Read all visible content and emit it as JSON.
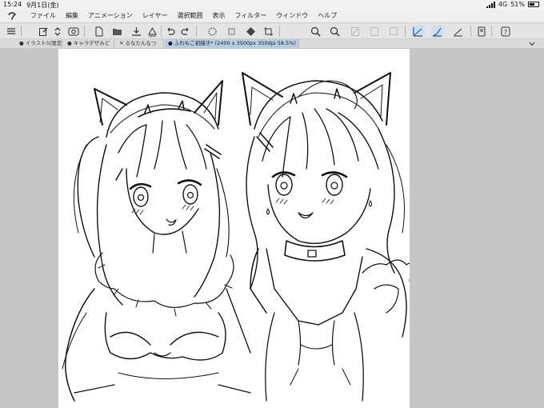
{
  "status": {
    "time": "15:24",
    "date": "9月1日(金)",
    "network": "4G",
    "battery": "51%",
    "battery_level": 0.51
  },
  "menu": {
    "items": [
      "ファイル",
      "編集",
      "アニメーション",
      "レイヤー",
      "選択範囲",
      "表示",
      "フィルター",
      "ウィンドウ",
      "ヘルプ"
    ]
  },
  "toolbar": {
    "icons": [
      "menu-icon",
      "new-canvas-icon",
      "arrows-icon",
      "lasso-icon",
      "new-page-icon",
      "open-folder-icon",
      "save-icon",
      "upload-icon",
      "undo-icon",
      "redo-icon",
      "sparkle-icon",
      "transform-icon",
      "fill-icon",
      "crop-icon",
      "zoom-in-icon",
      "zoom-out-icon",
      "disabled-icon",
      "invert-icon",
      "square-icon",
      "pen-pressure-icon",
      "brush-icon",
      "ruler-icon",
      "device-icon",
      "help-icon"
    ]
  },
  "tabs": [
    {
      "label": "● イラスト5(限定"
    },
    {
      "label": "● キャラデザみど"
    },
    {
      "label": "✕ るなたんなつ"
    },
    {
      "label": "● ふわもこ初描き* (2400 x 3500px 350dpi 58.5%)"
    }
  ],
  "colors": {
    "menubar_bg": "#efefef",
    "toolbar_bg": "#e4e4e4",
    "active_tab": "#b5cce4",
    "workspace": "#c6c6c6",
    "active_tool_highlight": "#cfe0f2",
    "ink": "#111111"
  }
}
